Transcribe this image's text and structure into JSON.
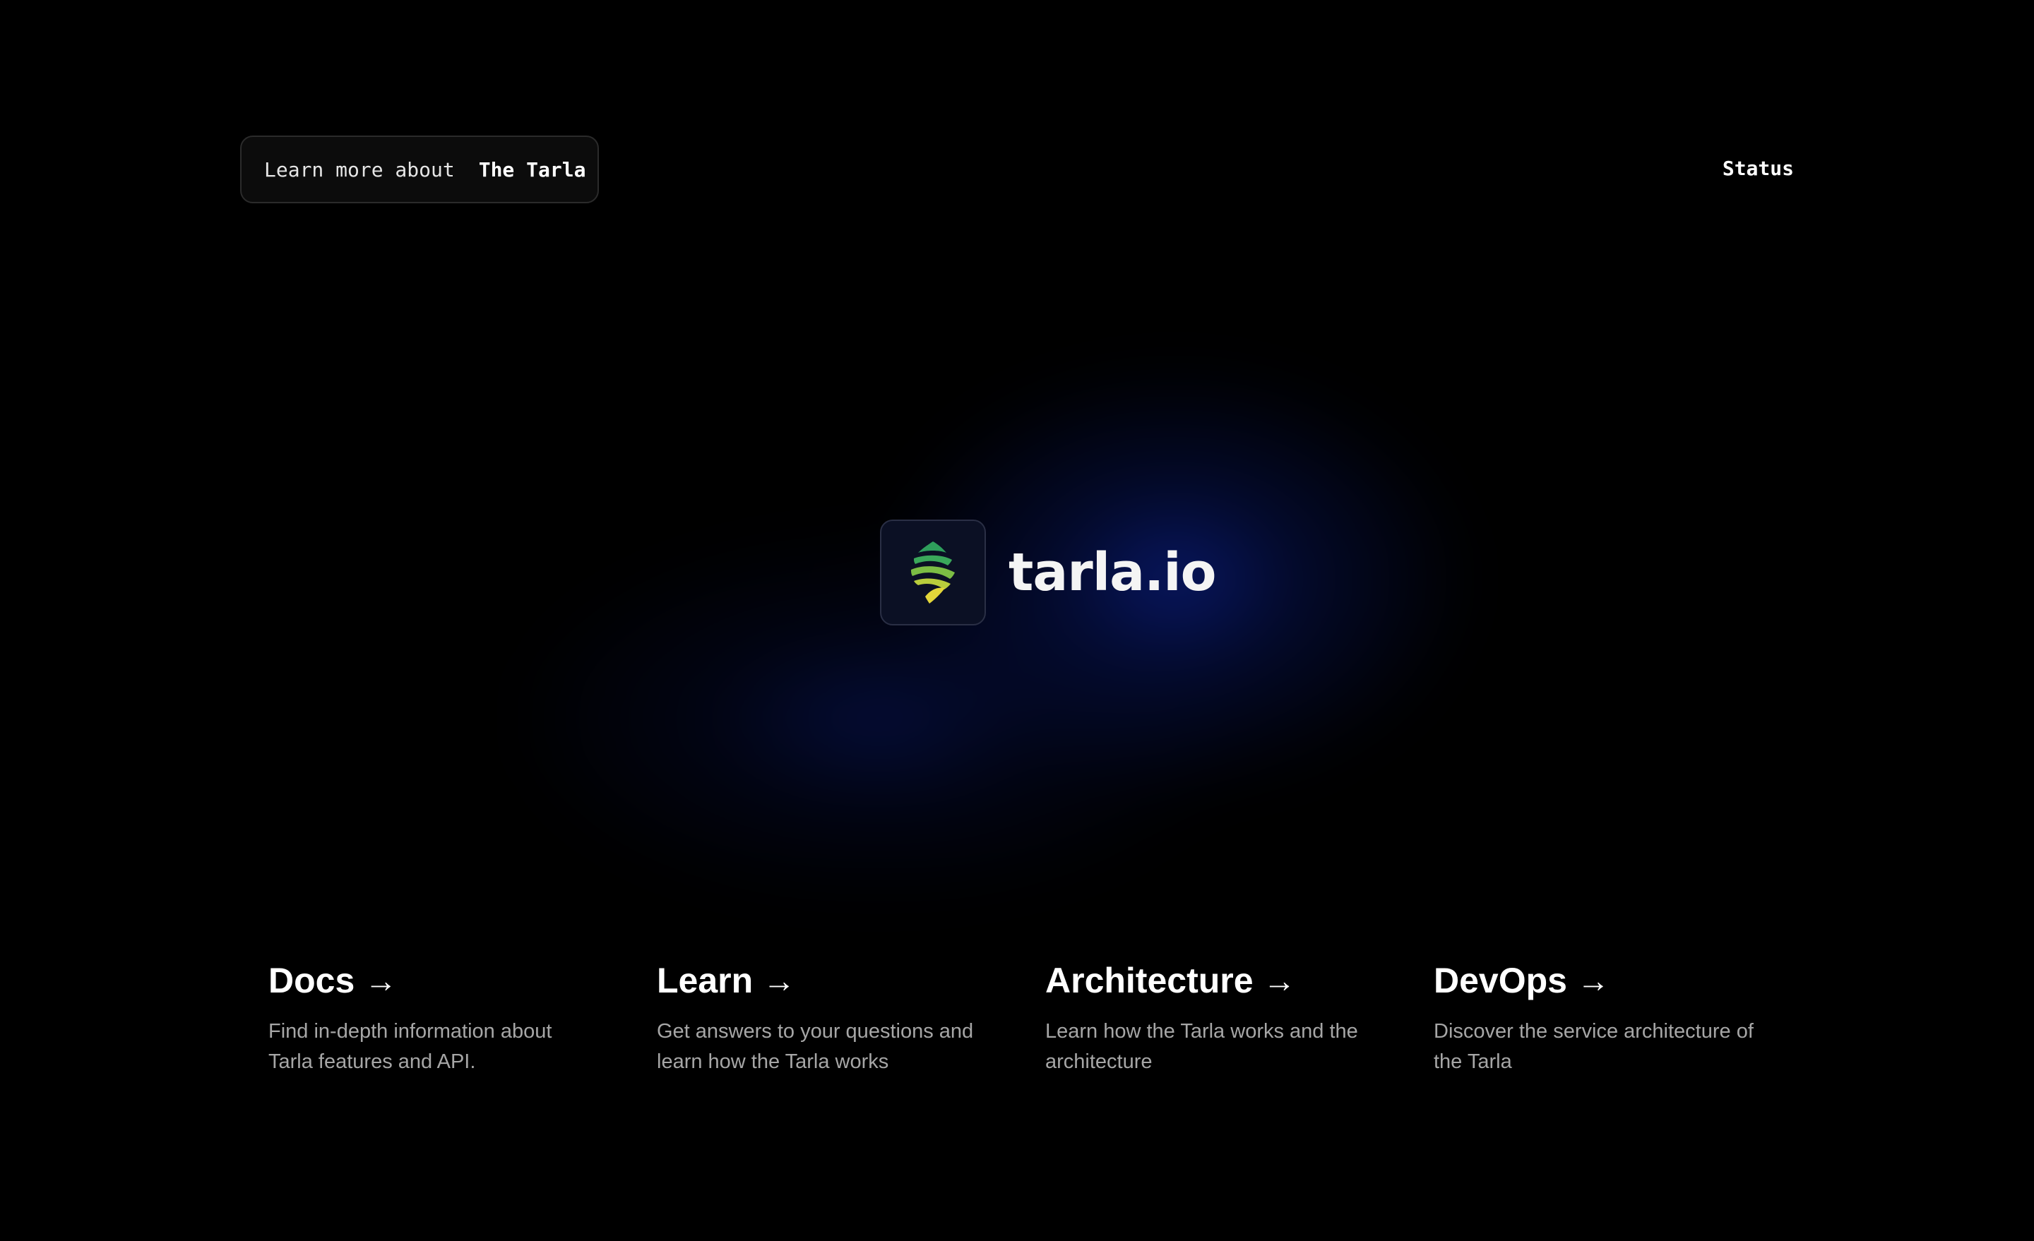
{
  "header": {
    "learn_prefix": "Learn more about",
    "learn_emphasis": "The Tarla",
    "status_label": "Status"
  },
  "brand": {
    "name": "tarla.io",
    "logo_icon": "tarla-leaf-icon"
  },
  "cards": [
    {
      "title": "Docs",
      "arrow": "→",
      "description": "Find in-depth information about Tarla features and API."
    },
    {
      "title": "Learn",
      "arrow": "→",
      "description": "Get answers to your questions and learn how the Tarla works"
    },
    {
      "title": "Architecture",
      "arrow": "→",
      "description": "Learn how the Tarla works and the architecture"
    },
    {
      "title": "DevOps",
      "arrow": "→",
      "description": "Discover the service architecture of the Tarla"
    }
  ],
  "colors": {
    "background": "#000000",
    "glow": "#0a1c78",
    "text": "#ffffff",
    "muted_text": "#a6a6a6",
    "logo_green": "#2e9e5b",
    "logo_yellow": "#e3d63a"
  }
}
